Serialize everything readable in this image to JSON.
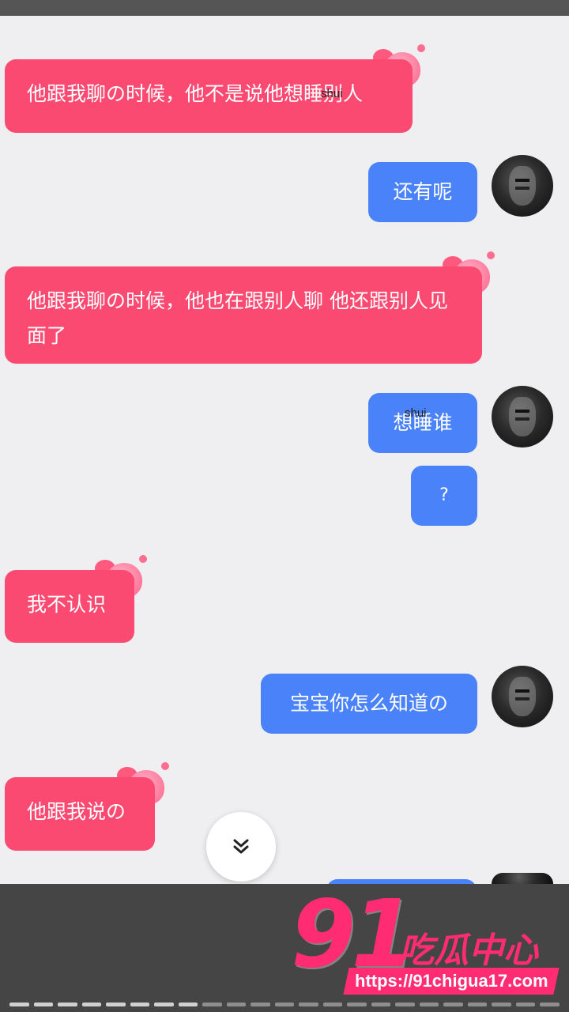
{
  "messages": [
    {
      "side": "left",
      "text": "他跟我聊の时候，他不是说他想睡别人"
    },
    {
      "side": "right",
      "text": "还有呢"
    },
    {
      "side": "left",
      "text": "他跟我聊の时候，他也在跟别人聊 他还跟别人见面了"
    },
    {
      "side": "right",
      "text": "想睡谁"
    },
    {
      "side": "right",
      "text": "?"
    },
    {
      "side": "left",
      "text": "我不认识"
    },
    {
      "side": "right",
      "text": "宝宝你怎么知道の"
    },
    {
      "side": "left",
      "text": "他跟我说の"
    }
  ],
  "overlay_text": {
    "shui": "shui"
  },
  "scroll_button": {
    "icon": "double-chevron-down-icon"
  },
  "watermark": {
    "number": "91",
    "cn": "吃瓜中心",
    "url": "https://91chigua17.com"
  },
  "progress": {
    "total_segments": 23,
    "completed_segments": 8
  },
  "colors": {
    "left_bubble": "#fb4a72",
    "right_bubble": "#4a82f9",
    "background": "#efeff1",
    "brand": "#ff2b73"
  }
}
